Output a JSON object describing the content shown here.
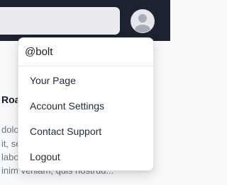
{
  "header": {
    "avatar_icon": "user-avatar-icon"
  },
  "background": {
    "title_fragment": "Roa",
    "lines": [
      "dolo",
      "it, se",
      "labo",
      "inim veniam, quis nostrud..."
    ]
  },
  "menu": {
    "username": "@bolt",
    "items": [
      {
        "label": "Your Page"
      },
      {
        "label": "Account Settings"
      },
      {
        "label": "Contact Support"
      },
      {
        "label": "Logout"
      }
    ]
  },
  "colors": {
    "header_bg": "#1c2230",
    "search_bg": "#e9ebee",
    "menu_bg": "#ffffff",
    "divider": "#e5e7eb"
  }
}
